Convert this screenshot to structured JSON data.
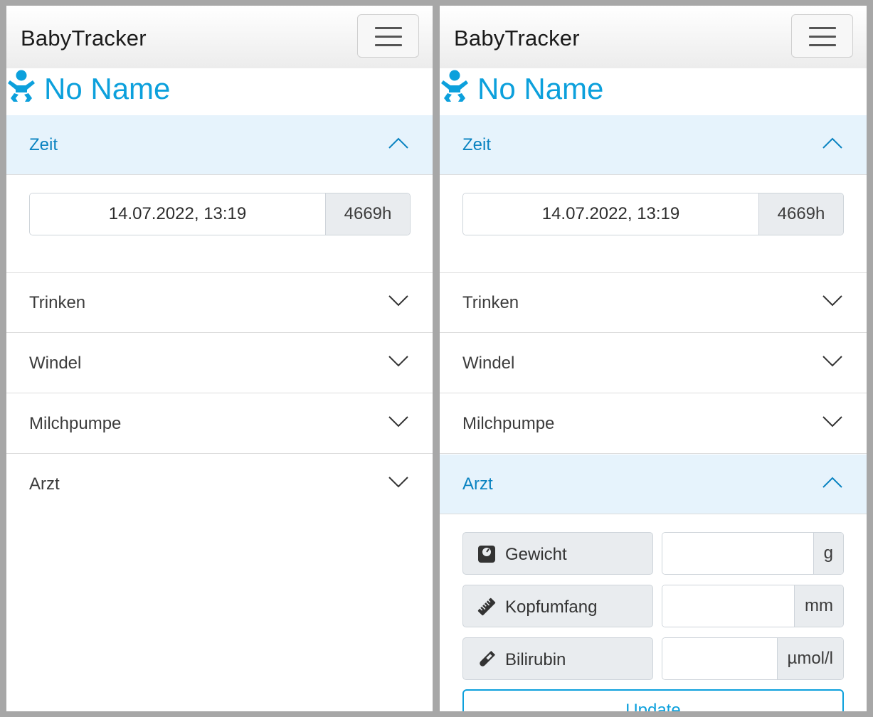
{
  "app": {
    "brand": "BabyTracker"
  },
  "baby": {
    "name": "No Name"
  },
  "time": {
    "value": "14.07.2022, 13:19",
    "elapsed": "4669h"
  },
  "sections": {
    "zeit": "Zeit",
    "trinken": "Trinken",
    "windel": "Windel",
    "milchpumpe": "Milchpumpe",
    "arzt": "Arzt"
  },
  "arzt_form": {
    "weight_label": "Gewicht",
    "weight_unit": "g",
    "head_label": "Kopfumfang",
    "head_unit": "mm",
    "bili_label": "Bilirubin",
    "bili_unit": "µmol/l",
    "update_label": "Update"
  },
  "colors": {
    "accent": "#0ca0dc",
    "open_header_bg": "#e6f3fc",
    "addon_bg": "#e9ecef"
  },
  "icons": [
    "hamburger-icon",
    "baby-icon",
    "chevron-up-icon",
    "chevron-down-icon",
    "scale-icon",
    "ruler-icon",
    "test-tube-icon"
  ]
}
